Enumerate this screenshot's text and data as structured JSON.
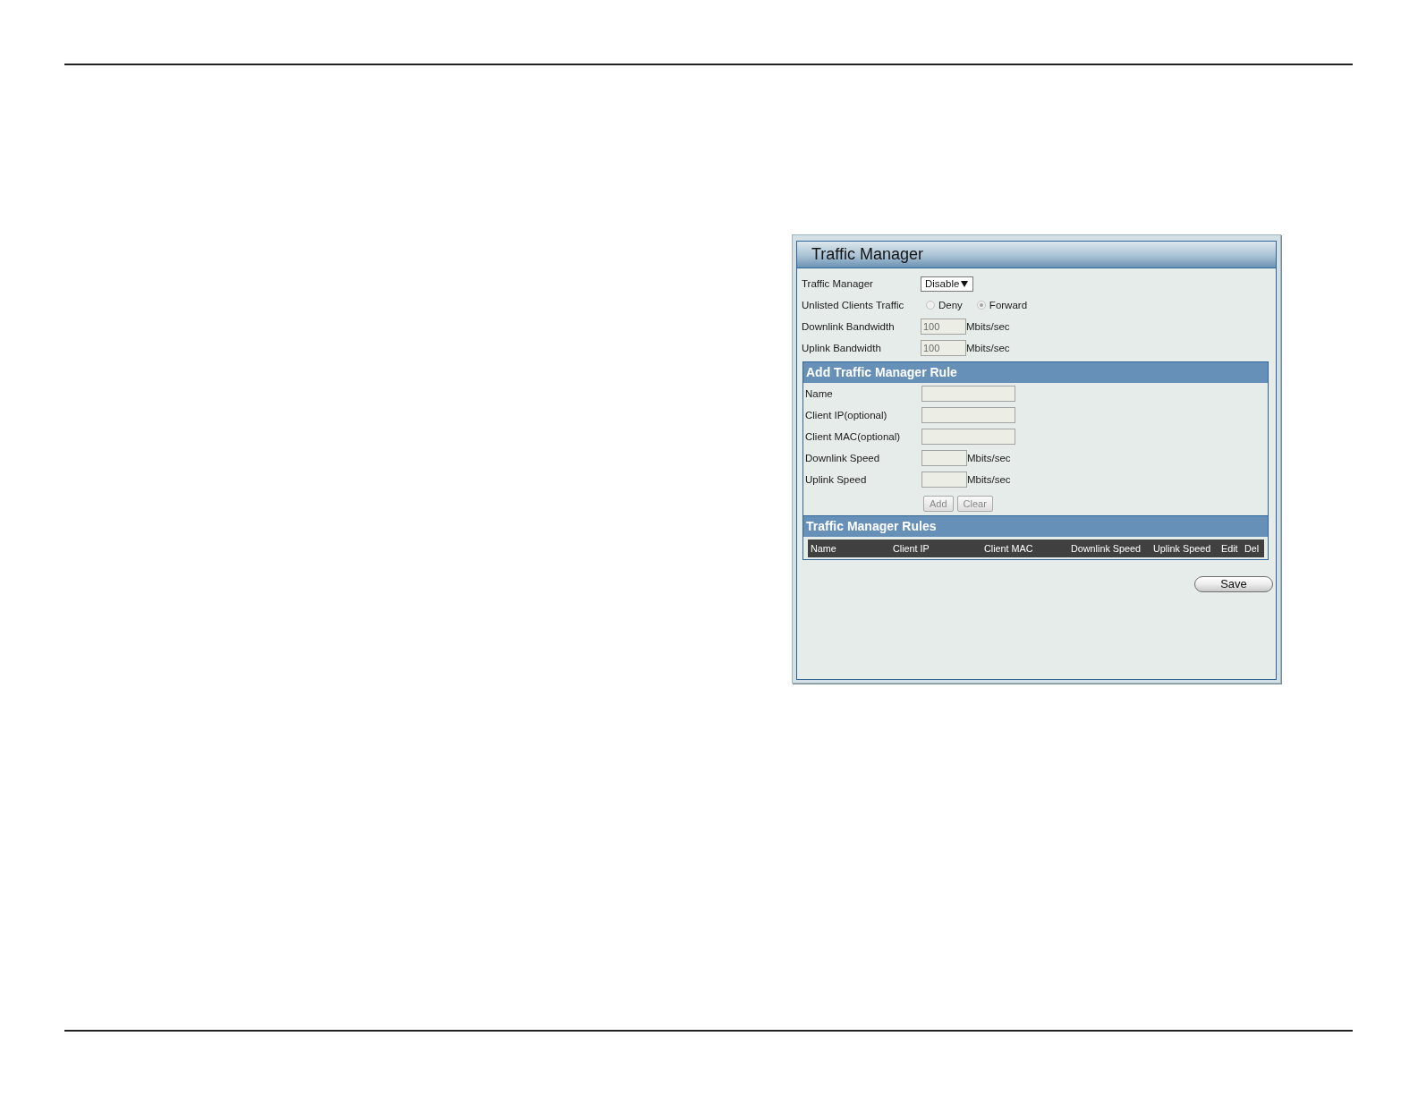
{
  "panel": {
    "title": "Traffic Manager",
    "settings": [
      {
        "kind": "select",
        "label": "Traffic Manager",
        "value": "Disable"
      },
      {
        "kind": "radio",
        "label": "Unlisted Clients Traffic",
        "disabled": true,
        "options": [
          {
            "label": "Deny",
            "selected": false
          },
          {
            "label": "Forward",
            "selected": true
          }
        ]
      },
      {
        "kind": "input",
        "label": "Downlink Bandwidth",
        "value": "100",
        "unit": "Mbits/sec",
        "disabled": true
      },
      {
        "kind": "input",
        "label": "Uplink Bandwidth",
        "value": "100",
        "unit": "Mbits/sec",
        "disabled": true
      }
    ],
    "add_rule": {
      "title": "Add Traffic Manager Rule",
      "fields": [
        {
          "label": "Name"
        },
        {
          "label": "Client IP(optional)"
        },
        {
          "label": "Client MAC(optional)"
        },
        {
          "label": "Downlink Speed",
          "unit": "Mbits/sec"
        },
        {
          "label": "Uplink Speed",
          "unit": "Mbits/sec"
        }
      ],
      "buttons": [
        {
          "label": "Add",
          "disabled": true
        },
        {
          "label": "Clear",
          "disabled": true
        }
      ]
    },
    "rules": {
      "title": "Traffic Manager Rules",
      "columns": [
        "Name",
        "Client IP",
        "Client MAC",
        "Downlink Speed",
        "Uplink Speed",
        "Edit",
        "Del"
      ]
    },
    "save_button": "Save"
  }
}
